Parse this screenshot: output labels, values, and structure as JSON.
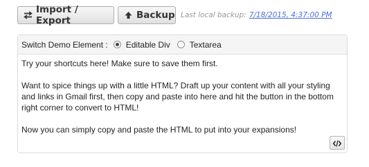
{
  "toolbar": {
    "import_export_label": "Import / Export",
    "backup_label": "Backup",
    "last_backup_prefix": "Last local backup:",
    "last_backup_link": "7/18/2015, 4:37:00 PM"
  },
  "demo": {
    "switch_label": "Switch Demo Element :",
    "options": [
      {
        "label": "Editable Div",
        "selected": true
      },
      {
        "label": "Textarea",
        "selected": false
      }
    ]
  },
  "editor": {
    "paragraphs": [
      "Try your shortcuts here! Make sure to save them first.",
      "Want to spice things up with a little HTML? Draft up your content with all your styling and links in Gmail first, then copy and paste into here and hit the button in the bottom right corner to convert to HTML!",
      "Now you can simply copy and paste the HTML to put into your expansions!"
    ],
    "convert_icon": "code-icon"
  },
  "icons": {
    "import_export": "swap-arrows-icon",
    "backup": "cloud-upload-icon"
  },
  "colors": {
    "link": "#4a6ee0",
    "muted": "#999999"
  }
}
